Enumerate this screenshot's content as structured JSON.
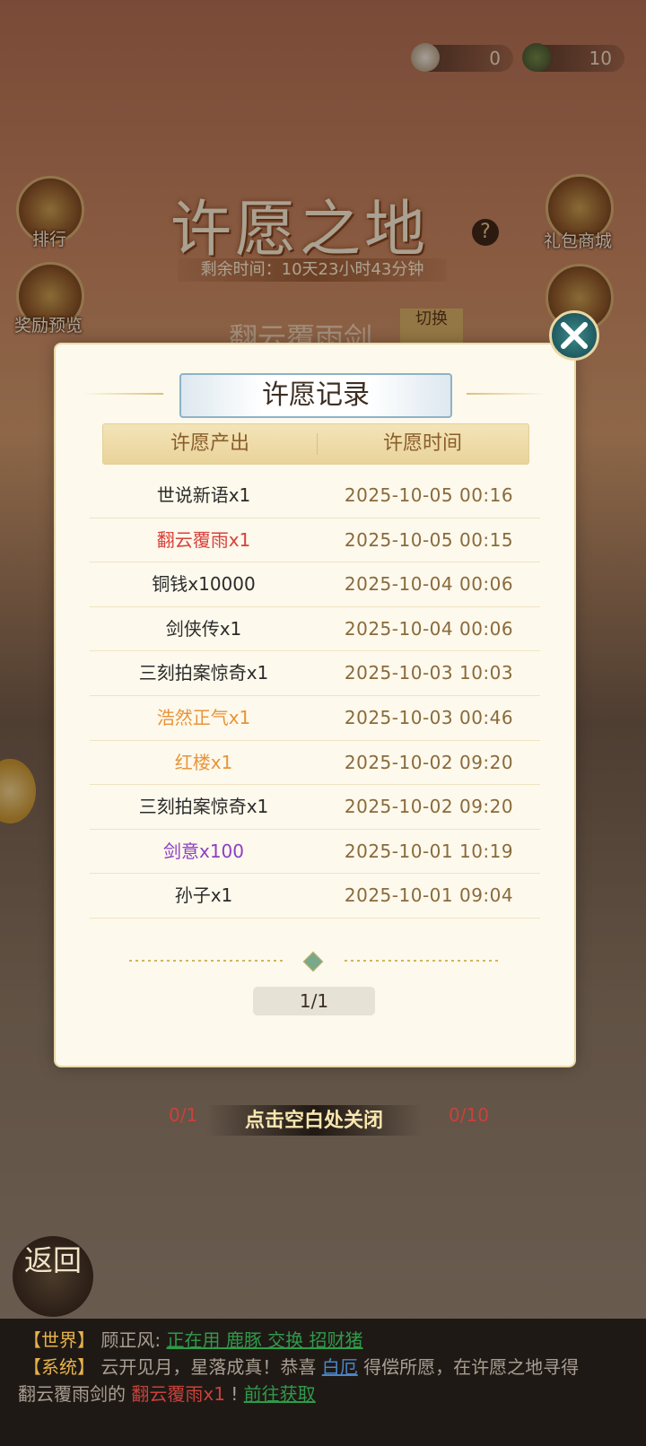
{
  "currency": [
    {
      "icon": "lotus-coin-icon",
      "value": "0"
    },
    {
      "icon": "bamboo-coin-icon",
      "value": "10"
    }
  ],
  "side_left": [
    {
      "label": "排行",
      "icon": "ranking-icon"
    },
    {
      "label": "奖励预览",
      "icon": "reward-chest-icon"
    }
  ],
  "side_right": [
    {
      "label": "礼包商城",
      "icon": "gift-bag-icon"
    }
  ],
  "event": {
    "title": "许愿之地",
    "help": "?",
    "timer": "剩余时间：10天23小时43分钟",
    "background_item": "翻云覆雨剑",
    "switch_label": "切换"
  },
  "modal": {
    "title": "许愿记录",
    "col_output": "许愿产出",
    "col_time": "许愿时间",
    "records": [
      {
        "item": "世说新语x1",
        "time": "2025-10-05  00:16",
        "color": "#2b2b2b"
      },
      {
        "item": "翻云覆雨x1",
        "time": "2025-10-05  00:15",
        "color": "#d8403a"
      },
      {
        "item": "铜钱x10000",
        "time": "2025-10-04  00:06",
        "color": "#2b2b2b"
      },
      {
        "item": "剑侠传x1",
        "time": "2025-10-04  00:06",
        "color": "#2b2b2b"
      },
      {
        "item": "三刻拍案惊奇x1",
        "time": "2025-10-03  10:03",
        "color": "#2b2b2b"
      },
      {
        "item": "浩然正气x1",
        "time": "2025-10-03  00:46",
        "color": "#e8943a"
      },
      {
        "item": "红楼x1",
        "time": "2025-10-02  09:20",
        "color": "#e8943a"
      },
      {
        "item": "三刻拍案惊奇x1",
        "time": "2025-10-02  09:20",
        "color": "#2b2b2b"
      },
      {
        "item": "剑意x100",
        "time": "2025-10-01  10:19",
        "color": "#8e3ec4"
      },
      {
        "item": "孙子x1",
        "time": "2025-10-01  09:04",
        "color": "#2b2b2b"
      }
    ],
    "page": "1/1"
  },
  "close_hint": "点击空白处关闭",
  "counters": [
    "0/1",
    "0/10"
  ],
  "back_label": "返回",
  "chat": {
    "line1": {
      "channel": "【世界】",
      "name": "顾正风:",
      "msg": "正在用 鹿豚 交换 招财猪"
    },
    "line2": {
      "channel": "【系统】",
      "msg_a": "云开见月，星落成真！恭喜",
      "player": "白厄",
      "msg_b": "得偿所愿，在许愿之地寻得"
    },
    "line3": {
      "msg_a": "翻云覆雨剑的",
      "item": "翻云覆雨x1",
      "msg_b": "!",
      "link": "前往获取"
    }
  }
}
